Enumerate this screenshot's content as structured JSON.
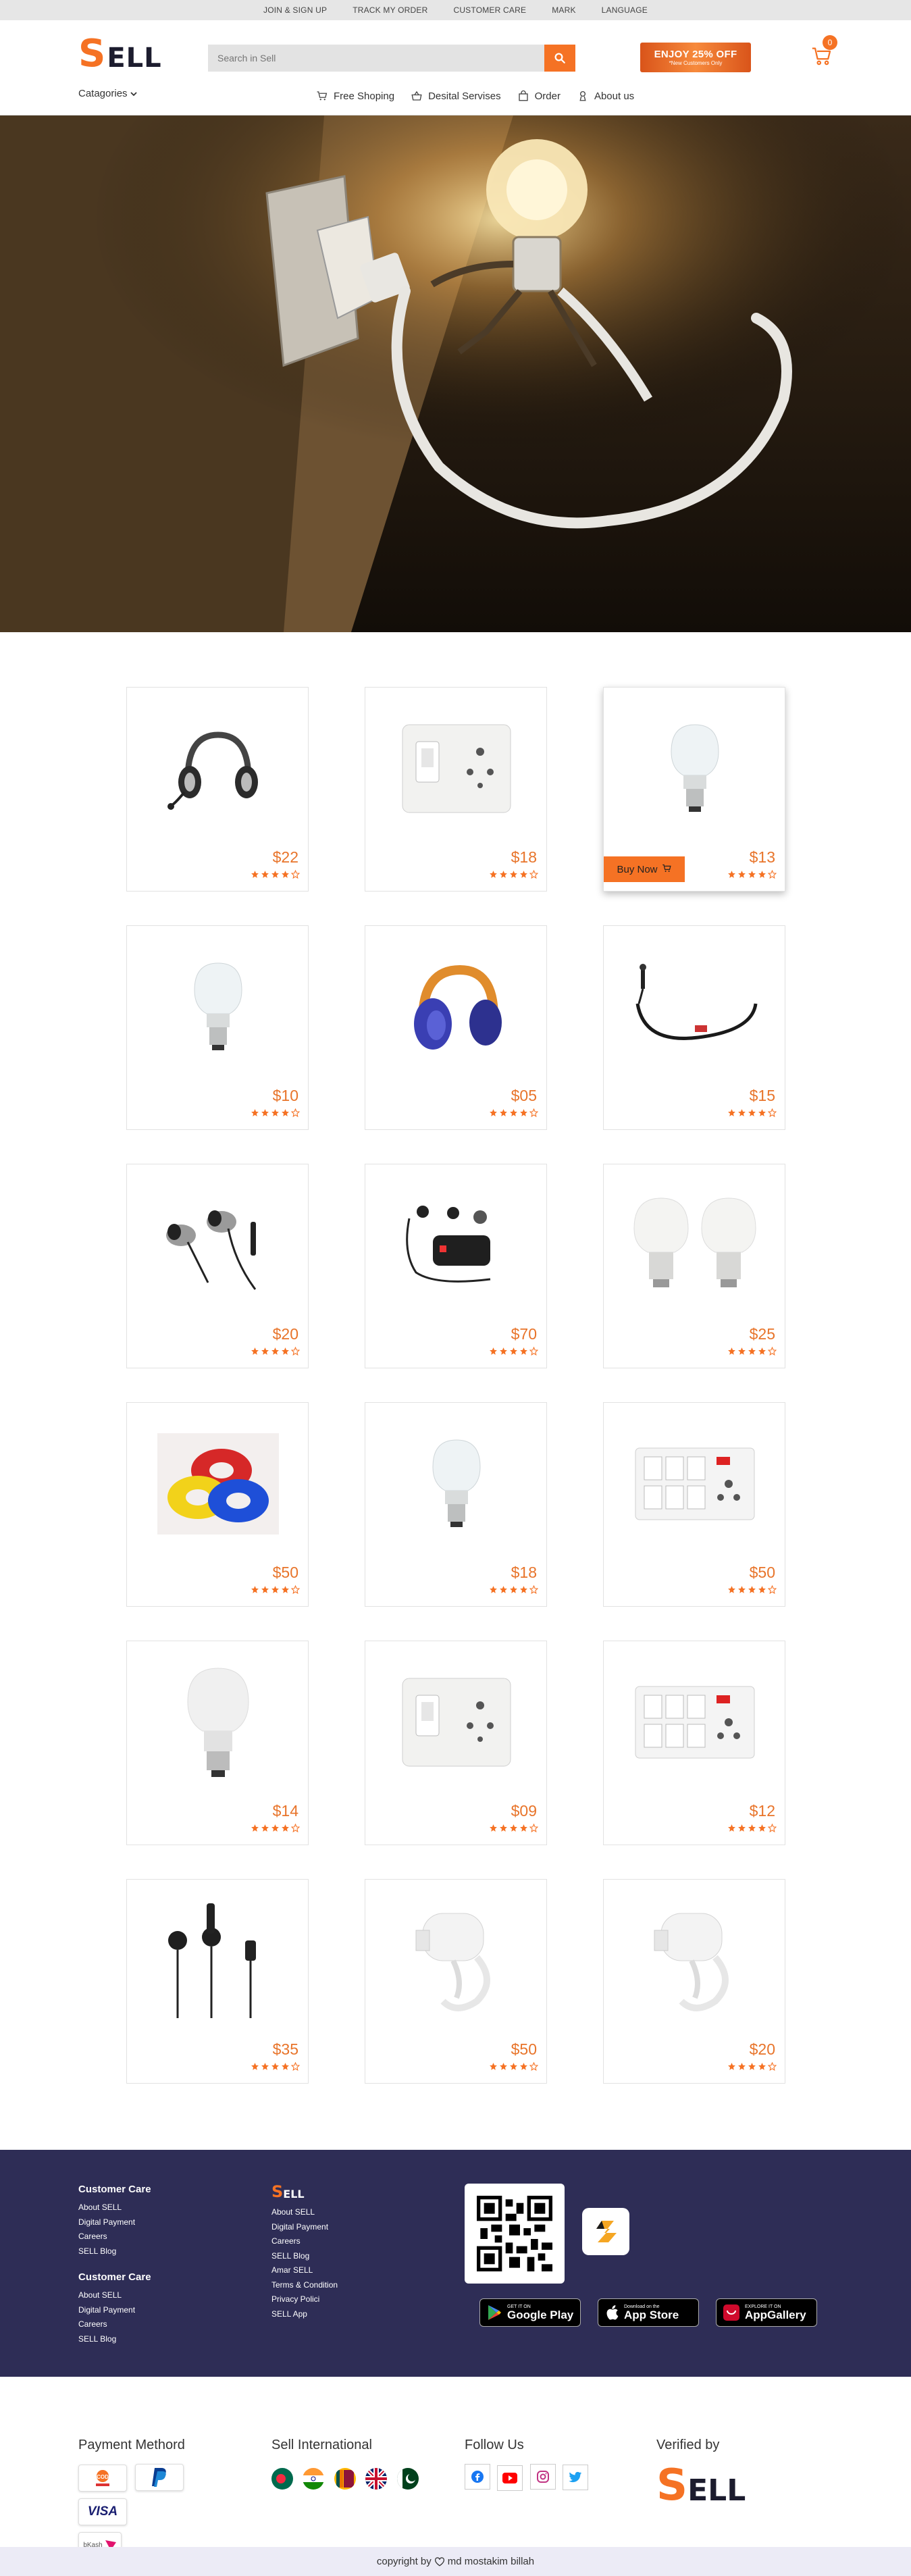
{
  "topbar": {
    "items": [
      "JOIN & SIGN UP",
      "TRACK MY ORDER",
      "CUSTOMER CARE",
      "MARK",
      "LANGUAGE"
    ]
  },
  "header": {
    "logo_first": "S",
    "logo_rest": "ELL",
    "search_placeholder": "Search in Sell",
    "promo_big": "ENJOY 25% OFF",
    "promo_small": "*New Customers Only",
    "cart_count": "0",
    "categories_label": "Catagories",
    "nav": [
      {
        "label": "Free Shoping",
        "icon": "cart-icon"
      },
      {
        "label": "Desital Servises",
        "icon": "basket-icon"
      },
      {
        "label": "Order",
        "icon": "bag-icon"
      },
      {
        "label": "About us",
        "icon": "person-icon"
      }
    ]
  },
  "products": [
    {
      "price": "$22",
      "rating": 4,
      "icon": "headset-icon"
    },
    {
      "price": "$18",
      "rating": 4,
      "icon": "switch-socket-icon"
    },
    {
      "price": "$13",
      "rating": 4,
      "icon": "led-bulb-icon",
      "buy_label": "Buy Now"
    },
    {
      "price": "$10",
      "rating": 4,
      "icon": "led-bulb-icon"
    },
    {
      "price": "$05",
      "rating": 4,
      "icon": "headphones-icon"
    },
    {
      "price": "$15",
      "rating": 4,
      "icon": "neckband-earphones-icon"
    },
    {
      "price": "$20",
      "rating": 4,
      "icon": "in-ear-earphones-icon"
    },
    {
      "price": "$70",
      "rating": 4,
      "icon": "earphones-box-icon"
    },
    {
      "price": "$25",
      "rating": 4,
      "icon": "two-bulbs-icon"
    },
    {
      "price": "$50",
      "rating": 4,
      "icon": "cable-rolls-icon"
    },
    {
      "price": "$18",
      "rating": 4,
      "icon": "led-bulb-icon"
    },
    {
      "price": "$50",
      "rating": 4,
      "icon": "switch-board-icon"
    },
    {
      "price": "$14",
      "rating": 4,
      "icon": "bulb-icon"
    },
    {
      "price": "$09",
      "rating": 4,
      "icon": "switch-socket-icon"
    },
    {
      "price": "$12",
      "rating": 4,
      "icon": "switch-board-icon"
    },
    {
      "price": "$35",
      "rating": 4,
      "icon": "type-c-earphones-icon"
    },
    {
      "price": "$50",
      "rating": 4,
      "icon": "hair-dryer-icon"
    },
    {
      "price": "$20",
      "rating": 4,
      "icon": "hair-dryer-icon"
    }
  ],
  "footer": {
    "col1_title": "Customer Care",
    "col1_links": [
      "About SELL",
      "Digital Payment",
      "Careers",
      "SELL Blog"
    ],
    "col1b_title": "Customer Care",
    "col1b_links": [
      "About SELL",
      "Digital Payment",
      "Careers",
      "SELL Blog"
    ],
    "col2_logo_first": "S",
    "col2_logo_rest": "ELL",
    "col2_links": [
      "About SELL",
      "Digital Payment",
      "Careers",
      "SELL Blog",
      "Amar SELL",
      "Terms & Condition",
      "Privacy Polici",
      "SELL App"
    ],
    "stores": [
      {
        "top": "GET IT ON",
        "name": "Google Play",
        "icon": "google-play-icon"
      },
      {
        "top": "Download on the",
        "name": "App Store",
        "icon": "apple-icon"
      },
      {
        "top": "EXPLORE IT ON",
        "name": "AppGallery",
        "icon": "huawei-icon"
      }
    ]
  },
  "lower": {
    "payment_title": "Payment Methord",
    "payment_methods": [
      "COD",
      "PayPal",
      "VISA",
      "bKash"
    ],
    "international_title": "Sell International",
    "flags": [
      "Bangladesh",
      "India",
      "Sri Lanka",
      "United Kingdom",
      "Pakistan"
    ],
    "follow_title": "Follow Us",
    "socials": [
      "facebook-icon",
      "youtube-icon",
      "instagram-icon",
      "twitter-icon"
    ],
    "verified_title": "Verified by",
    "verified_logo_first": "S",
    "verified_logo_rest": "ELL"
  },
  "copyright": {
    "before": "copyright by",
    "after": "md mostakim billah"
  },
  "colors": {
    "accent": "#f57224",
    "footer_bg": "#2e2d56",
    "copyright_bg": "#ecebf6",
    "price": "#e8742a"
  }
}
